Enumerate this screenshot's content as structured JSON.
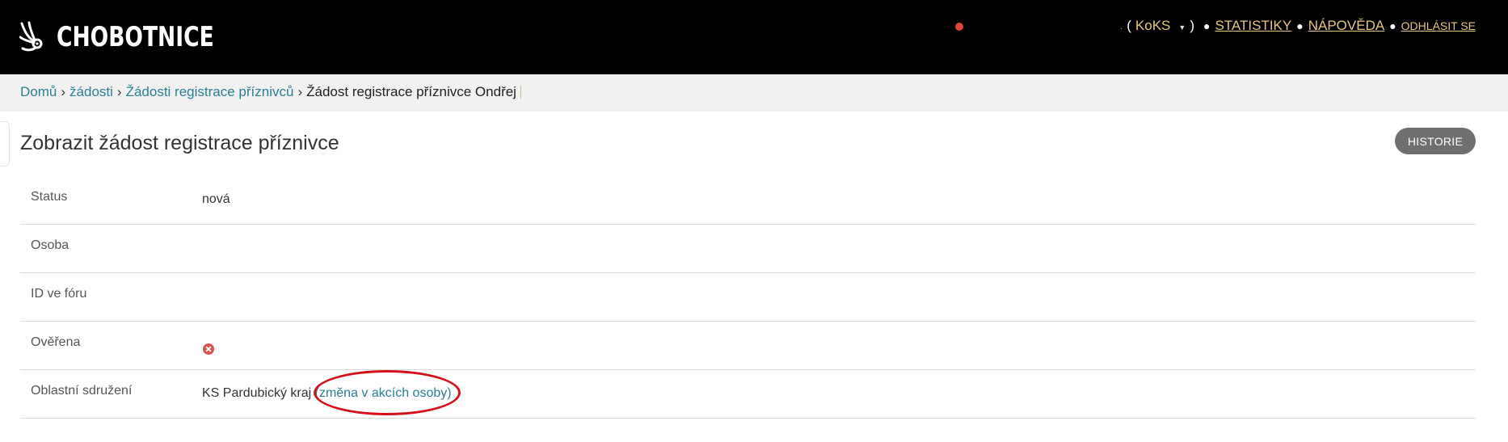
{
  "header": {
    "logo_text": "CHOBOTNICE",
    "user_nav": {
      "username_fragment": ".",
      "open_paren": "(",
      "role": "KoKS",
      "caret": "▼",
      "close_paren": ")",
      "bullet": "●",
      "statistics_label": "STATISTIKY",
      "help_label": "NÁPOVĚDA",
      "logout_label": "ODHLÁSIT SE"
    }
  },
  "breadcrumb": {
    "items": [
      "Domů",
      "žádosti",
      "Žádosti registrace příznivců"
    ],
    "separator": "›",
    "current": "Žádost registrace příznivce Ondřej"
  },
  "page": {
    "title": "Zobrazit žádost registrace příznivce",
    "history_button": "HISTORIE"
  },
  "details": {
    "status": {
      "label": "Status",
      "value": "nová"
    },
    "person": {
      "label": "Osoba",
      "value": ""
    },
    "forum_id": {
      "label": "ID ve fóru",
      "value": ""
    },
    "verified": {
      "label": "Ověřena",
      "icon": "x-circle-icon"
    },
    "region": {
      "label": "Oblastní sdružení",
      "value": "KS Pardubický kraj",
      "link": "(změna v akcích osoby)"
    }
  },
  "colors": {
    "header_bg": "#000000",
    "accent_link": "#2a7f93",
    "nav_link": "#e6c67c",
    "status_new": "#e08a10",
    "annotation": "#d4111a"
  }
}
